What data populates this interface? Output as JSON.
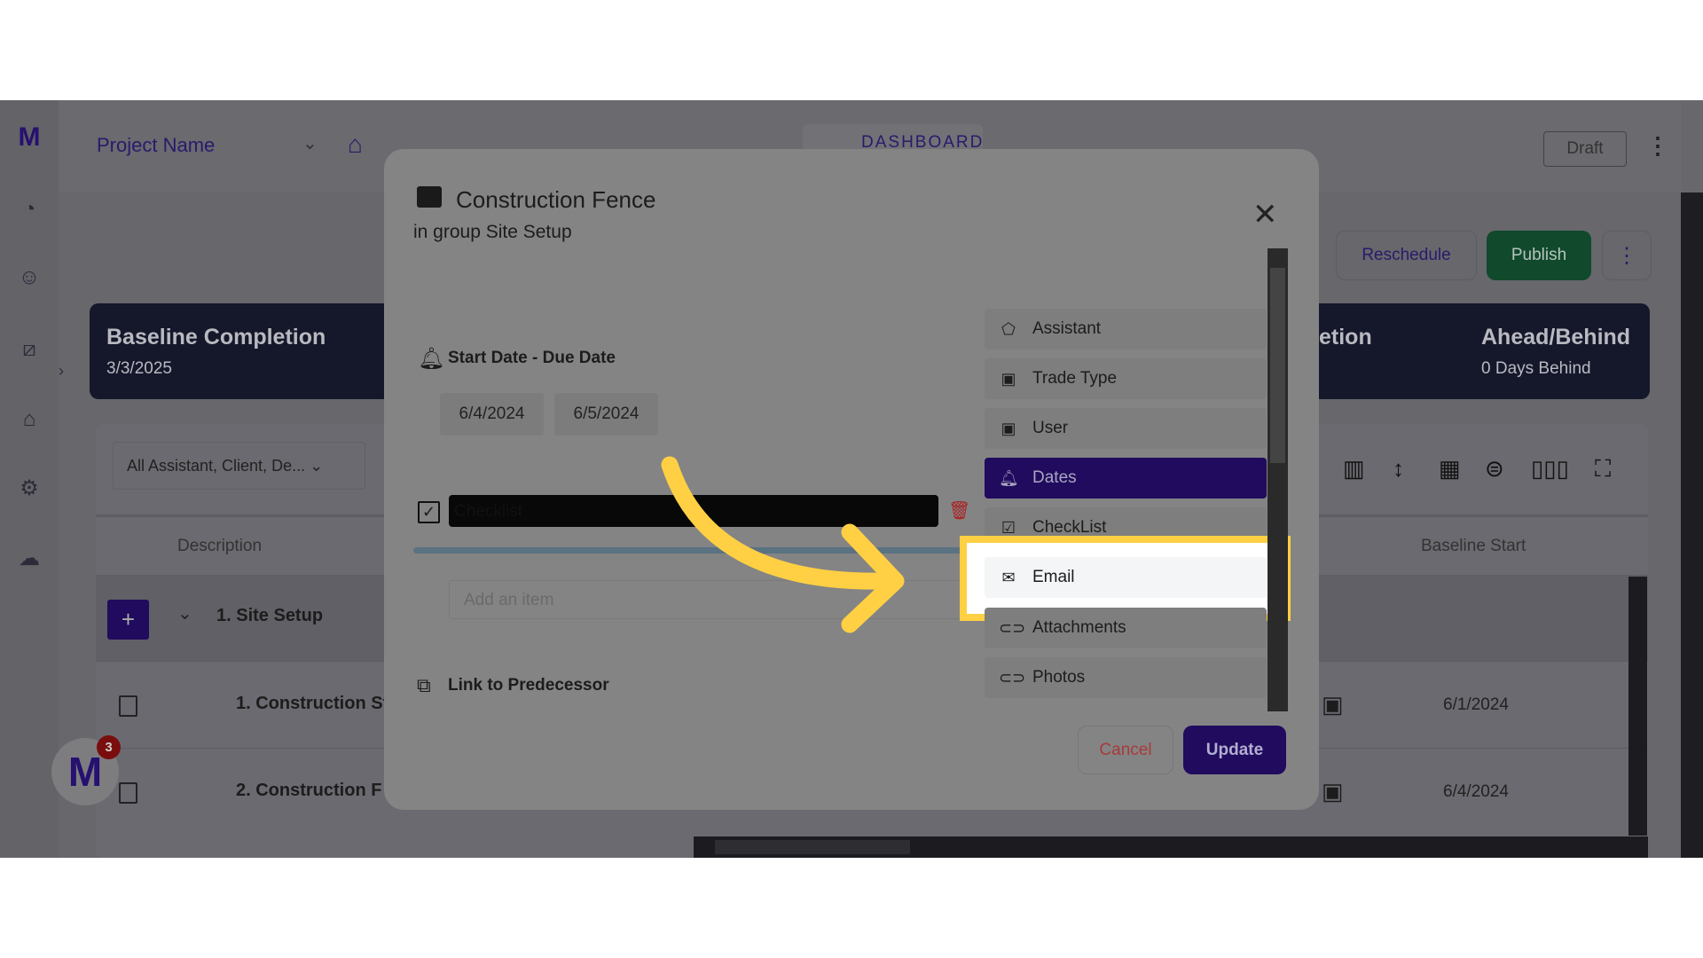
{
  "header": {
    "project_name": "Project Name",
    "dashboard_tab": "DASHBOARD",
    "draft_label": "Draft"
  },
  "actions": {
    "reschedule": "Reschedule",
    "publish": "Publish"
  },
  "summary": {
    "baseline_label": "Baseline Completion",
    "baseline_value": "3/3/2025",
    "hidden_label_fragment": "etion",
    "ahead_label": "Ahead/Behind",
    "ahead_value": "0 Days Behind"
  },
  "filter": {
    "value": "All Assistant, Client, De..."
  },
  "table": {
    "columns": [
      "Description",
      "Baseline Start"
    ],
    "rows": [
      {
        "label": "1. Site Setup",
        "type": "group"
      },
      {
        "label": "1. Construction St",
        "baseline_start": "6/1/2024"
      },
      {
        "label": "2. Construction F",
        "baseline_start": "6/4/2024"
      }
    ]
  },
  "notifications": {
    "badge": "3"
  },
  "modal": {
    "title": "Construction Fence",
    "subtitle": "in group Site Setup",
    "dates_label": "Start Date - Due Date",
    "start_date": "6/4/2024",
    "due_date": "6/5/2024",
    "checklist_title": "Checklist",
    "add_item_placeholder": "Add an item",
    "predecessor_label": "Link to Predecessor",
    "menu": [
      {
        "label": "Assistant",
        "icon": "tag-icon"
      },
      {
        "label": "Trade Type",
        "icon": "badge-icon"
      },
      {
        "label": "User",
        "icon": "badge-icon"
      },
      {
        "label": "Dates",
        "icon": "bell-icon",
        "active": true
      },
      {
        "label": "CheckList",
        "icon": "checkbox-icon"
      },
      {
        "label": "Email",
        "icon": "mail-icon",
        "highlighted": true
      },
      {
        "label": "Attachments",
        "icon": "paperclip-icon"
      },
      {
        "label": "Photos",
        "icon": "paperclip-icon"
      }
    ],
    "cancel": "Cancel",
    "update": "Update"
  },
  "colors": {
    "accent": "#200b5e",
    "publish": "#10492c",
    "highlight": "#ffd043",
    "cancel_text": "#a83a3a"
  }
}
